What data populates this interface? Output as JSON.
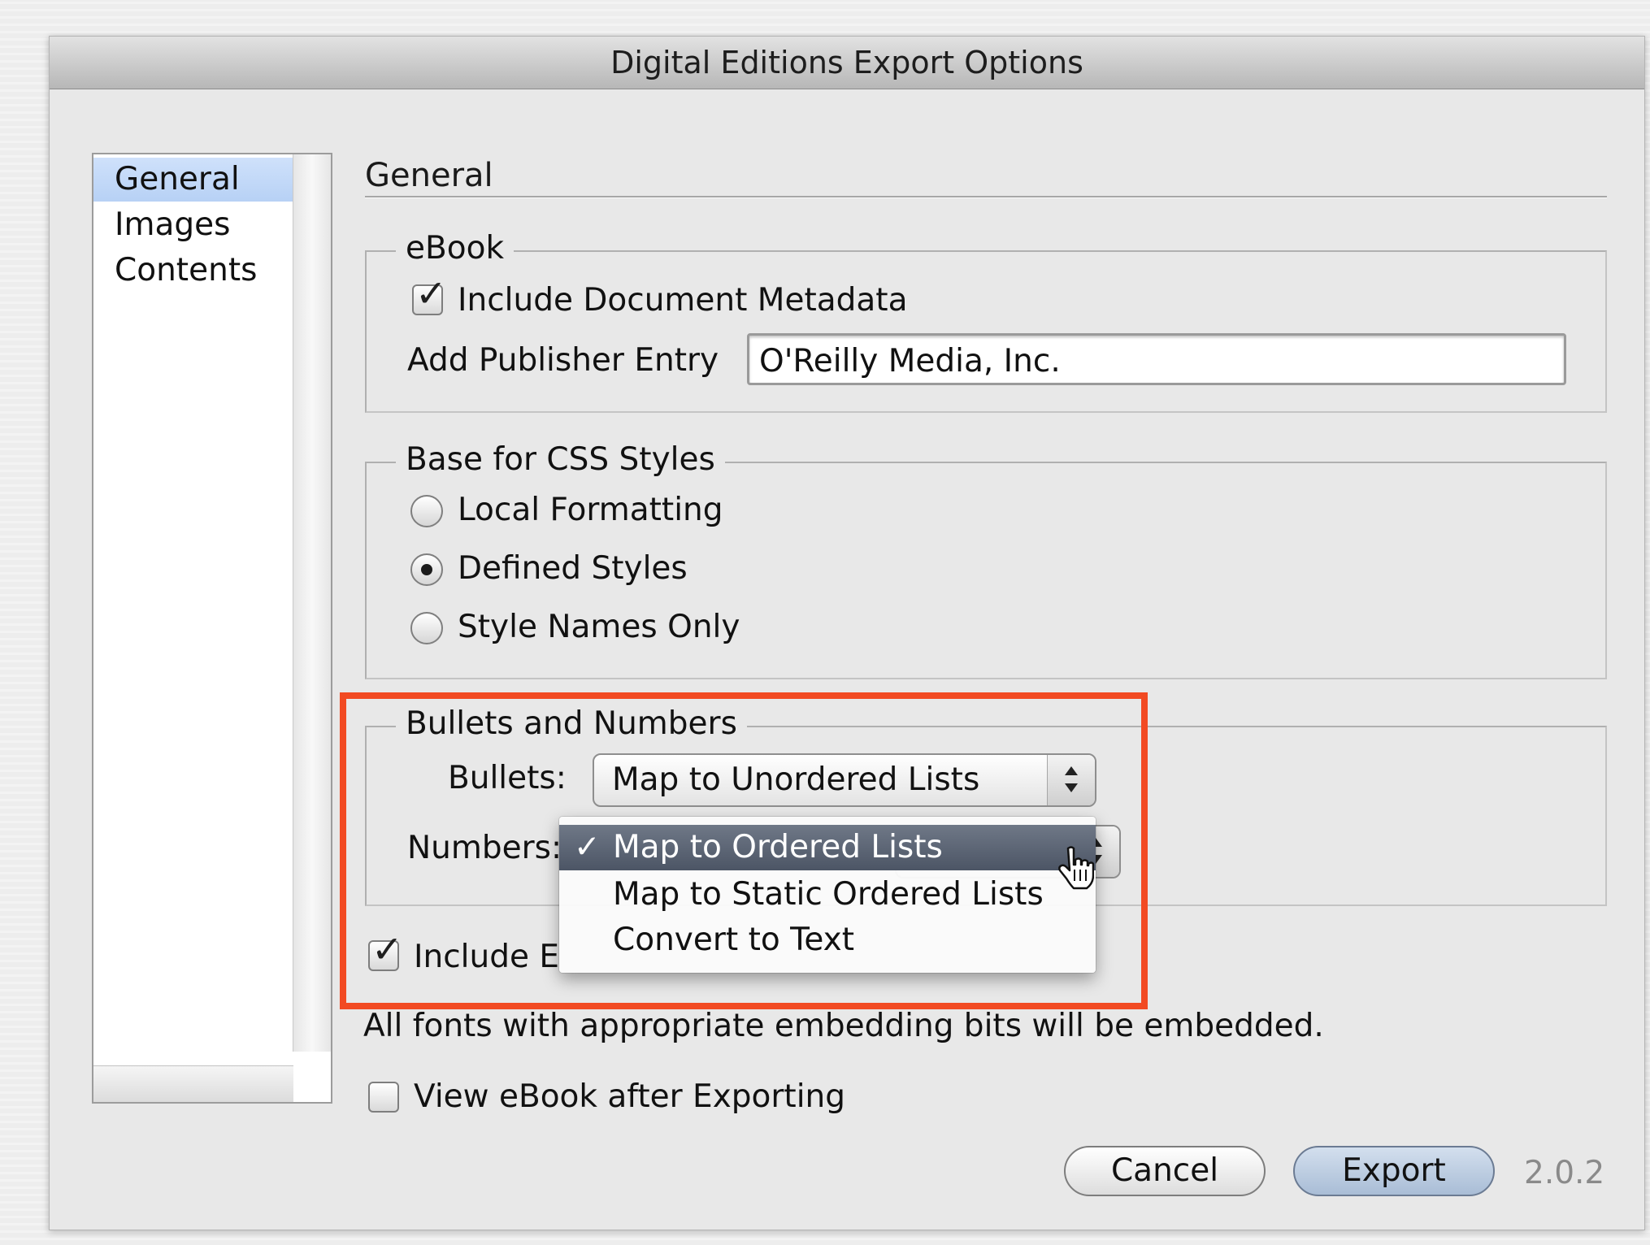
{
  "window": {
    "title": "Digital Editions Export Options"
  },
  "sidebar": {
    "items": [
      {
        "label": "General",
        "selected": true
      },
      {
        "label": "Images",
        "selected": false
      },
      {
        "label": "Contents",
        "selected": false
      }
    ]
  },
  "section_title": "General",
  "ebook": {
    "legend": "eBook",
    "include_metadata": {
      "label": "Include Document Metadata",
      "checked": true
    },
    "publisher": {
      "label": "Add Publisher Entry",
      "value": "O'Reilly Media, Inc."
    }
  },
  "css_styles": {
    "legend": "Base for CSS Styles",
    "options": [
      {
        "label": "Local Formatting",
        "selected": false
      },
      {
        "label": "Defined Styles",
        "selected": true
      },
      {
        "label": "Style Names Only",
        "selected": false
      }
    ]
  },
  "bullets_numbers": {
    "legend": "Bullets and Numbers",
    "bullets": {
      "label": "Bullets:",
      "value": "Map to Unordered Lists"
    },
    "numbers": {
      "label": "Numbers:",
      "menu": [
        {
          "label": "Map to Ordered Lists",
          "checked": true,
          "check_glyph": "✓"
        },
        {
          "label": "Map to Static Ordered Lists",
          "checked": false
        },
        {
          "label": "Convert to Text",
          "checked": false
        }
      ]
    }
  },
  "include_embeddable_fonts": {
    "label_visible": "Include E",
    "checked": true
  },
  "fonts_note": "All fonts with appropriate embedding bits will be embedded.",
  "view_after_export": {
    "label": "View eBook after Exporting",
    "checked": false
  },
  "buttons": {
    "cancel": "Cancel",
    "export": "Export"
  },
  "version": "2.0.2",
  "colors": {
    "highlight_box": "#f24a22",
    "sidebar_selection": "#c3d8f8",
    "menu_highlight": "#5a6373"
  }
}
